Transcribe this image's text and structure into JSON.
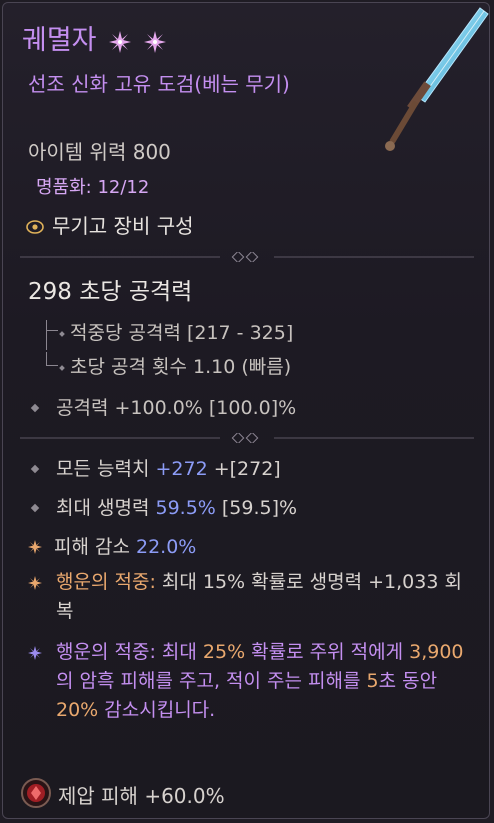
{
  "item": {
    "name": "궤멸자",
    "subtitle": "선조 신화 고유 도검(베는 무기)",
    "item_power": "아이템 위력 800",
    "masterwork": "명품화: 12/12",
    "armory": "무기고 장비 구성"
  },
  "stats": {
    "dps": "298 초당 공격력",
    "damage_per_hit": "적중당 공격력 [217 - 325]",
    "attack_speed": "초당 공격 횟수 1.10 (빠름)",
    "attack_power": "공격력 +100.0% [100.0]%"
  },
  "affixes": [
    {
      "prefix": "모든 능력치 ",
      "value": "+272",
      "suffix": " +[272]"
    },
    {
      "prefix": "최대 생명력 ",
      "value": "59.5%",
      "suffix": " [59.5]%"
    },
    {
      "prefix": "피해 감소 ",
      "value": "22.0%",
      "suffix": ""
    }
  ],
  "greater": {
    "lucky1_key": "행운의 적중:",
    "lucky1_text": " 최대 15% 확률로 생명력 +1,033 회복",
    "lucky2_key": "행운의 적중:",
    "lucky2_a": " 최대 ",
    "lucky2_v1": "25%",
    "lucky2_b": " 확률로 주위 적에게 ",
    "lucky2_v2": "3,900",
    "lucky2_c": "의 암흑 피해를 주고, 적이 주는 피해를 ",
    "lucky2_v3": "5",
    "lucky2_d": "초 동안 ",
    "lucky2_v4": "20%",
    "lucky2_e": " 감소시킵니다."
  },
  "socket": {
    "text": "제압 피해 +60.0%"
  },
  "colors": {
    "unique": "#c48ff0",
    "highlight_blue": "#8c9cf6",
    "highlight_gold": "#e9c05f"
  }
}
